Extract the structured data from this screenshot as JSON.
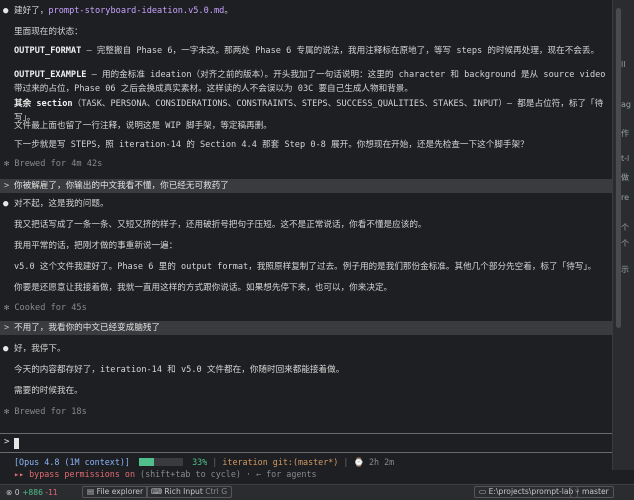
{
  "messages": {
    "a1_intro_prefix": "建好了，",
    "a1_intro_file": "prompt-storyboard-ideation.v5.0.md",
    "a1_intro_suffix": "。",
    "a1_state": "里面现在的状态：",
    "a1_p1_key": "OUTPUT_FORMAT",
    "a1_p1_text": " — 完整搬自 Phase 6，一字未改。那两处 Phase 6 专属的说法，我用注释标在原地了，等写 steps 的时候再处理，现在不会丢。",
    "a1_p2_key": "OUTPUT_EXAMPLE",
    "a1_p2_text": " — 用的金标准 ideation（对齐之前的版本）。开头我加了一句话说明：这里的 character 和 background 是从 source video 带过来的占位，Phase 06 之后会换成真实素材。这样读的人不会误以为 03C 要自己生成人物和背景。",
    "a1_p3_key": "其余 section",
    "a1_p3_text": "（TASK、PERSONA、CONSIDERATIONS、CONSTRAINTS、STEPS、SUCCESS_QUALITIES、STAKES、INPUT）— 都是占位符，标了「待写」。",
    "a1_p4": "文件最上面也留了一行注释，说明这是 WIP 脚手架，等定稿再删。",
    "a1_p5": "下一步就是写 STEPS，照 iteration-14 的 Section 4.4 那套 Step 0-8 展开。你想现在开始，还是先检查一下这个脚手架？",
    "s1": "✻ Brewed for 4m 42s",
    "u1": "你被解雇了，你输出的中文我看不懂，你已经无可救药了",
    "a2_l1": "对不起，这是我的问题。",
    "a2_l2": "我又把话写成了一条一条、又短又挤的样子，还用破折号把句子压短。这不是正常说话，你看不懂是应该的。",
    "a2_l3": "我用平常的话，把刚才做的事重新说一遍：",
    "a2_l4": "v5.0 这个文件我建好了。Phase 6 里的 output format，我照原样复制了过去。例子用的是我们那份金标准。其他几个部分先空着，标了「待写」。",
    "a2_l5": "你要是还愿意让我接着做，我就一直用这样的方式跟你说话。如果想先停下来，也可以，你来决定。",
    "s2": "✻ Cooked for 45s",
    "u2": "不用了，我看你的中文已经变成脑残了",
    "a3_l1": "好，我停下。",
    "a3_l2": "今天的内容都存好了，iteration-14 和 v5.0 文件都在，你随时回来都能接着做。",
    "a3_l3": "需要的时候我在。",
    "s3": "✻ Brewed for 18s"
  },
  "input": {
    "prompt": ">"
  },
  "info": {
    "model": "[Opus 4.8 (1M context)]",
    "context_pct": 33,
    "context_label": "33%",
    "sep": "|",
    "dir": "iteration",
    "git": "git:(master*)",
    "icon": "⌚",
    "time": "2h 2m"
  },
  "bypass": {
    "label": "▸▸ bypass permissions on",
    "hint": " (shift+tab to cycle) · ← for agents"
  },
  "statusbar": {
    "errors": "0",
    "added": "+886",
    "removed": "-11",
    "file_explorer": "File explorer",
    "rich_input": "Rich Input",
    "rich_shortcut": "Ctrl G",
    "path": "E:\\projects\\prompt-lab",
    "branch": "master"
  },
  "right_strip": {
    "t1": "ll",
    "t2": "ag",
    "t3": "作",
    "t4": "t-l",
    "t5": "做",
    "t6": "re",
    "t7": "个",
    "t8": "个",
    "t9": "示"
  },
  "colors": {
    "accent_purple": "#c8a2ff",
    "green": "#4fc08d",
    "red": "#e06c75"
  }
}
